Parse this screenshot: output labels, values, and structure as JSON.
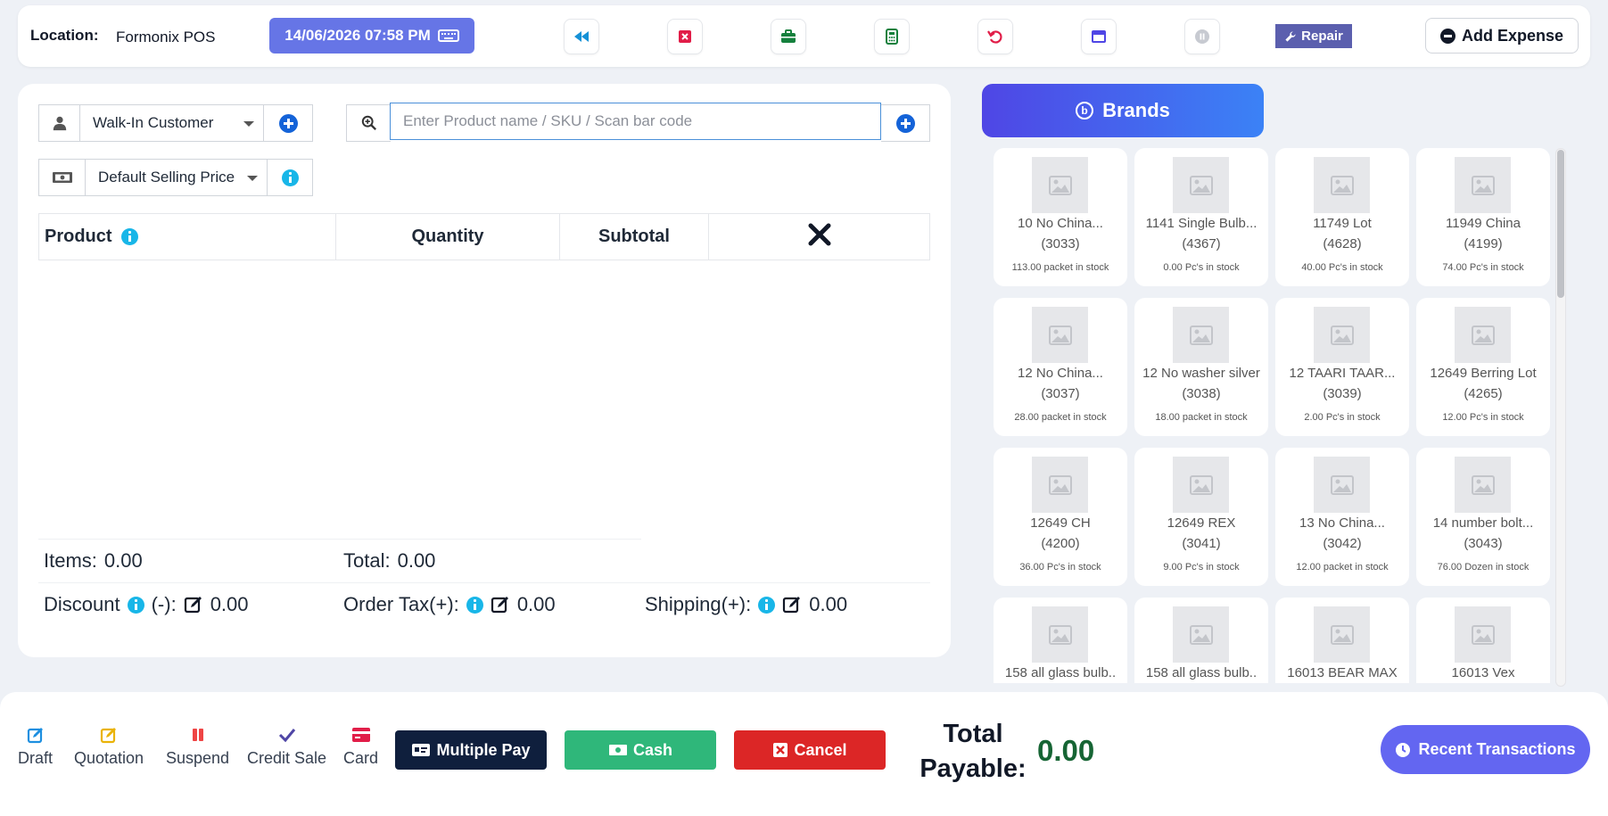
{
  "header": {
    "location_label": "Location:",
    "location_value": "Formonix POS",
    "datetime": "14/06/2026 07:58 PM",
    "repair_label": "Repair",
    "add_expense_label": "Add Expense",
    "icons": [
      "rewind-icon",
      "close-square-icon",
      "briefcase-icon",
      "calculator-icon",
      "undo-icon",
      "window-icon",
      "pause-icon"
    ]
  },
  "customer": {
    "selected": "Walk-In Customer"
  },
  "price_group": {
    "selected": "Default Selling Price"
  },
  "search": {
    "placeholder": "Enter Product name / SKU / Scan bar code"
  },
  "table": {
    "columns": {
      "product": "Product",
      "quantity": "Quantity",
      "subtotal": "Subtotal"
    }
  },
  "summary": {
    "items_label": "Items:",
    "items_value": "0.00",
    "total_label": "Total:",
    "total_value": "0.00",
    "discount_label": "Discount",
    "discount_sign": "(-):",
    "discount_value": "0.00",
    "order_tax_label": "Order Tax(+):",
    "order_tax_value": "0.00",
    "shipping_label": "Shipping(+):",
    "shipping_value": "0.00"
  },
  "brands": {
    "label": "Brands"
  },
  "products": [
    {
      "name": "10 No China...",
      "sku": "(3033)",
      "stock": "113.00 packet in stock"
    },
    {
      "name": "1141 Single Bulb...",
      "sku": "(4367)",
      "stock": "0.00 Pc's in stock"
    },
    {
      "name": "11749 Lot",
      "sku": "(4628)",
      "stock": "40.00 Pc's in stock"
    },
    {
      "name": "11949 China",
      "sku": "(4199)",
      "stock": "74.00 Pc's in stock"
    },
    {
      "name": "12 No China...",
      "sku": "(3037)",
      "stock": "28.00 packet in stock"
    },
    {
      "name": "12 No washer silver",
      "sku": "(3038)",
      "stock": "18.00 packet in stock"
    },
    {
      "name": "12 TAARI TAAR...",
      "sku": "(3039)",
      "stock": "2.00 Pc's in stock"
    },
    {
      "name": "12649 Berring Lot",
      "sku": "(4265)",
      "stock": "12.00 Pc's in stock"
    },
    {
      "name": "12649 CH",
      "sku": "(4200)",
      "stock": "36.00 Pc's in stock"
    },
    {
      "name": "12649 REX",
      "sku": "(3041)",
      "stock": "9.00 Pc's in stock"
    },
    {
      "name": "13 No China...",
      "sku": "(3042)",
      "stock": "12.00 packet in stock"
    },
    {
      "name": "14 number bolt...",
      "sku": "(3043)",
      "stock": "76.00 Dozen in stock"
    },
    {
      "name": "158 all glass bulb..",
      "sku": "",
      "stock": ""
    },
    {
      "name": "158 all glass bulb..",
      "sku": "",
      "stock": ""
    },
    {
      "name": "16013 BEAR MAX",
      "sku": "",
      "stock": ""
    },
    {
      "name": "16013 Vex",
      "sku": "",
      "stock": ""
    }
  ],
  "footer": {
    "draft": "Draft",
    "quotation": "Quotation",
    "suspend": "Suspend",
    "credit_sale": "Credit Sale",
    "card": "Card",
    "multiple_pay": "Multiple Pay",
    "cash": "Cash",
    "cancel": "Cancel",
    "total_payable_label": "Total Payable:",
    "total_payable_value": "0.00",
    "recent_transactions": "Recent Transactions"
  },
  "colors": {
    "accent": "#6675e6",
    "brands_gradient_start": "#4f46e5",
    "brands_gradient_end": "#3b82f6",
    "multiple_pay": "#0f1f3d",
    "cash": "#2fb77a",
    "cancel": "#dc2626",
    "total_green": "#166534"
  }
}
